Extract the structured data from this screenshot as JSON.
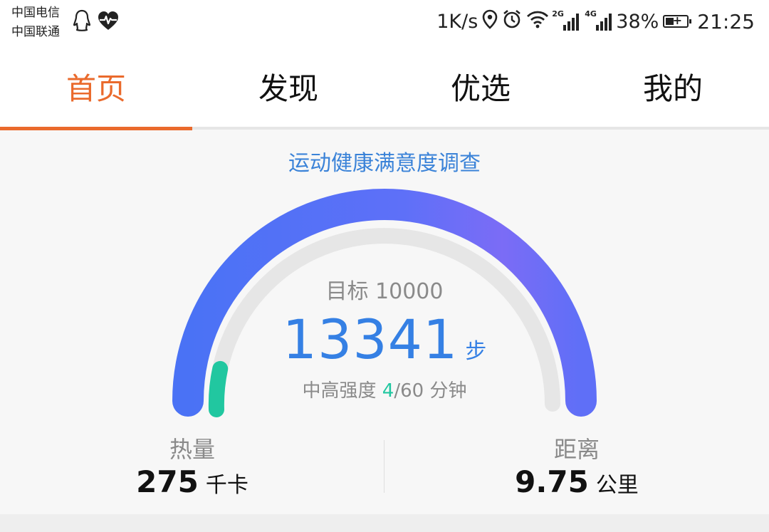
{
  "status_bar": {
    "carrier_1": "中国电信",
    "carrier_2": "中国联通",
    "left_icons": [
      "qq-penguin-icon",
      "heart-rate-icon"
    ],
    "speed": "1K/s",
    "right_icons": [
      "location-pin-icon",
      "alarm-clock-icon",
      "wifi-icon"
    ],
    "network_1": "2G",
    "network_2": "4G",
    "battery_percent": "38%",
    "battery_charging": true,
    "time": "21:25"
  },
  "tabs": [
    {
      "label": "首页",
      "active": true
    },
    {
      "label": "发现",
      "active": false
    },
    {
      "label": "优选",
      "active": false
    },
    {
      "label": "我的",
      "active": false
    }
  ],
  "survey_link": "运动健康满意度调查",
  "activity": {
    "goal_text": "目标 10000",
    "steps": "13341",
    "steps_unit": "步",
    "intensity_prefix": "中高强度 ",
    "intensity_current": "4",
    "intensity_rest": "/60 分钟",
    "intensity_fraction": 0.0667,
    "steps_goal_fraction": 1.0
  },
  "stats": {
    "calories": {
      "label": "热量",
      "value": "275",
      "unit": "千卡"
    },
    "distance": {
      "label": "距离",
      "value": "9.75",
      "unit": "公里"
    }
  },
  "colors": {
    "accent": "#ea6a2c",
    "link": "#3b83d8",
    "steps": "#3580e4",
    "gauge_start": "#4a72f5",
    "gauge_end": "#7b6cf6",
    "intensity": "#21c7a0"
  }
}
